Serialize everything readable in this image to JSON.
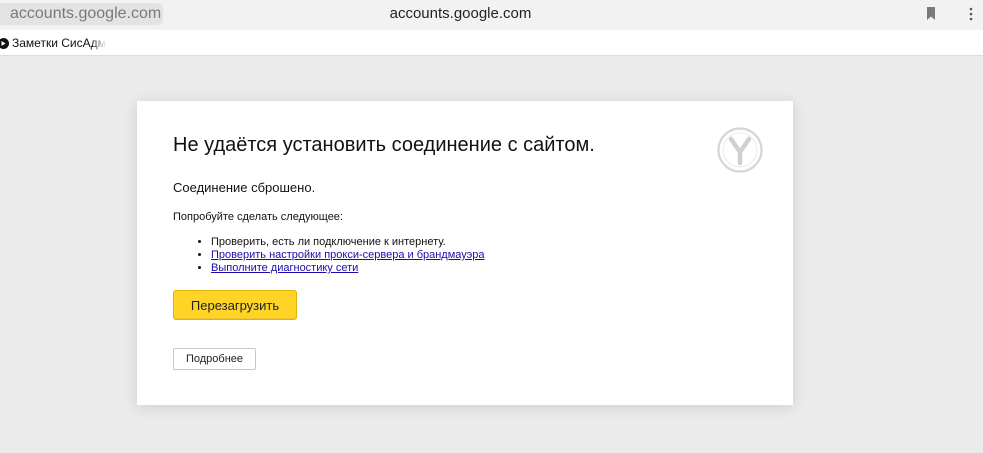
{
  "browser": {
    "tab_title": "accounts.google.com",
    "address": "accounts.google.com",
    "icons": [
      "bookmark-icon",
      "menu-icon"
    ]
  },
  "bookmarks_bar": {
    "items": [
      {
        "label": "Заметки СисАдм",
        "icon": "site-favicon-icon"
      }
    ]
  },
  "error_page": {
    "logo": "yandex-browser-logo-icon",
    "title": "Не удаётся установить соединение с сайтом.",
    "subtitle": "Соединение сброшено.",
    "try_heading": "Попробуйте сделать следующее:",
    "suggestions": [
      {
        "text": "Проверить, есть ли подключение к интернету.",
        "link": false
      },
      {
        "text": "Проверить настройки прокси-сервера и брандмауэра",
        "link": true
      },
      {
        "text": "Выполните диагностику сети",
        "link": true
      }
    ],
    "reload_label": "Перезагрузить",
    "details_label": "Подробнее"
  },
  "colors": {
    "page_background": "#ebebeb",
    "reload_button": "#ffd427",
    "link": "#1a0dab"
  }
}
